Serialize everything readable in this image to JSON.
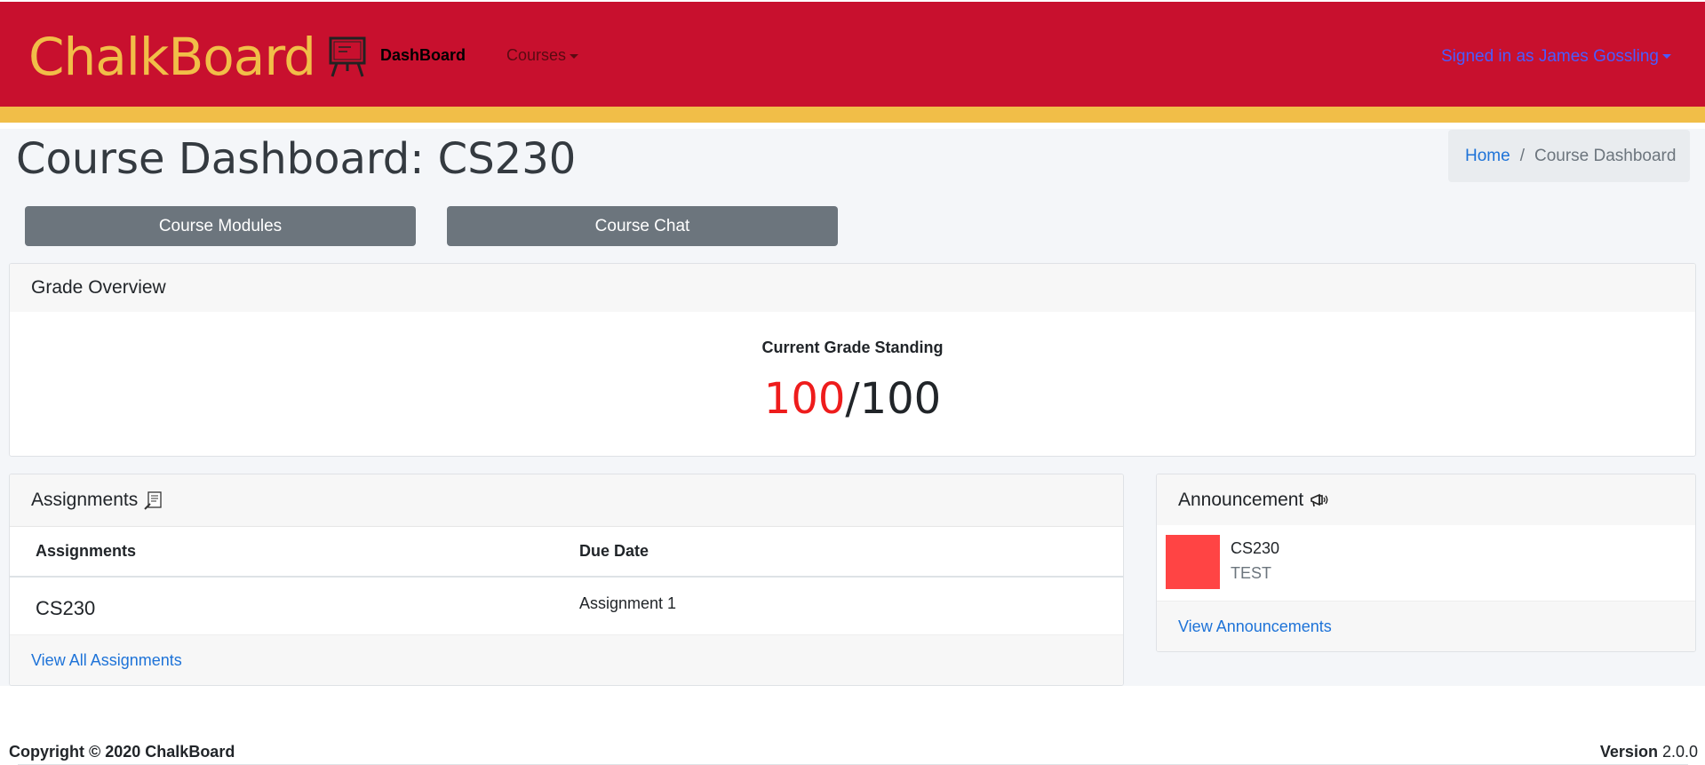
{
  "navbar": {
    "brand": "ChalkBoard",
    "brand_icon": "chalkboard-icon",
    "links": {
      "dashboard": "DashBoard",
      "courses": "Courses"
    },
    "user_menu": "Signed in as James Gossling",
    "colors": {
      "primary": "#c8102e",
      "accent": "#f1be48"
    }
  },
  "page": {
    "title": "Course Dashboard: CS230",
    "breadcrumb": {
      "home": "Home",
      "separator": "/",
      "current": "Course Dashboard"
    }
  },
  "actions": {
    "modules": "Course Modules",
    "chat": "Course Chat"
  },
  "grade_overview": {
    "header": "Grade Overview",
    "label": "Current Grade Standing",
    "score": "100",
    "separator": "/",
    "total": "100"
  },
  "assignments": {
    "header": "Assignments",
    "header_icon": "assignment-icon",
    "columns": {
      "name": "Assignments",
      "due": "Due Date"
    },
    "rows": [
      {
        "course": "CS230",
        "assignment": "Assignment 1"
      }
    ],
    "footer_link": "View All Assignments"
  },
  "announcements": {
    "header": "Announcement",
    "header_icon": "megaphone-icon",
    "items": [
      {
        "course": "CS230",
        "text": "TEST",
        "color": "#ff4444"
      }
    ],
    "footer_link": "View Announcements"
  },
  "footer": {
    "copyright": "Copyright © 2020 ChalkBoard",
    "version_label": "Version",
    "version_value": "2.0.0"
  }
}
